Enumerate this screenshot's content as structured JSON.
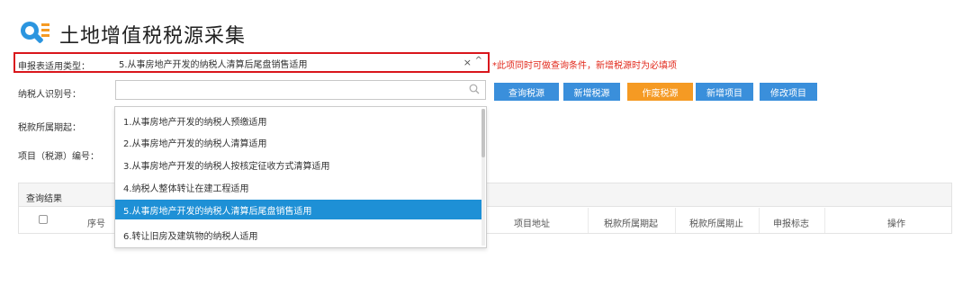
{
  "page": {
    "title": "土地增值税税源采集"
  },
  "form": {
    "report_type_label": "申报表适用类型：",
    "report_type_value": "5.从事房地产开发的纳税人清算后尾盘销售适用",
    "clear_symbol": "×",
    "chevron_symbol": "^",
    "hint": "*此项同时可做查询条件，新增税源时为必填项",
    "taxpayer_id_label": "纳税人识别号：",
    "taxpayer_id_value": "",
    "tax_period_label": "税款所属期起：",
    "project_no_label": "项目（税源）编号："
  },
  "buttons": {
    "query": "查询税源",
    "add": "新增税源",
    "void": "作废税源",
    "add_project": "新增项目",
    "edit_project": "修改项目"
  },
  "dropdown": {
    "options": [
      "1.从事房地产开发的纳税人预缴适用",
      "2.从事房地产开发的纳税人清算适用",
      "3.从事房地产开发的纳税人按核定征收方式清算适用",
      "4.纳税人整体转让在建工程适用",
      "5.从事房地产开发的纳税人清算后尾盘销售适用",
      "6.转让旧房及建筑物的纳税人适用"
    ],
    "selected_index": 4
  },
  "results": {
    "title": "查询结果",
    "columns": {
      "seq": "序号",
      "address": "项目地址",
      "period_start": "税款所属期起",
      "period_end": "税款所属期止",
      "flag": "申报标志",
      "action": "操作"
    }
  },
  "colors": {
    "accent_blue": "#3a8fdb",
    "accent_orange": "#f59a23",
    "selected_item": "#1e90d6",
    "highlight_border": "#d9161c",
    "hint_red": "#e22a1c"
  }
}
